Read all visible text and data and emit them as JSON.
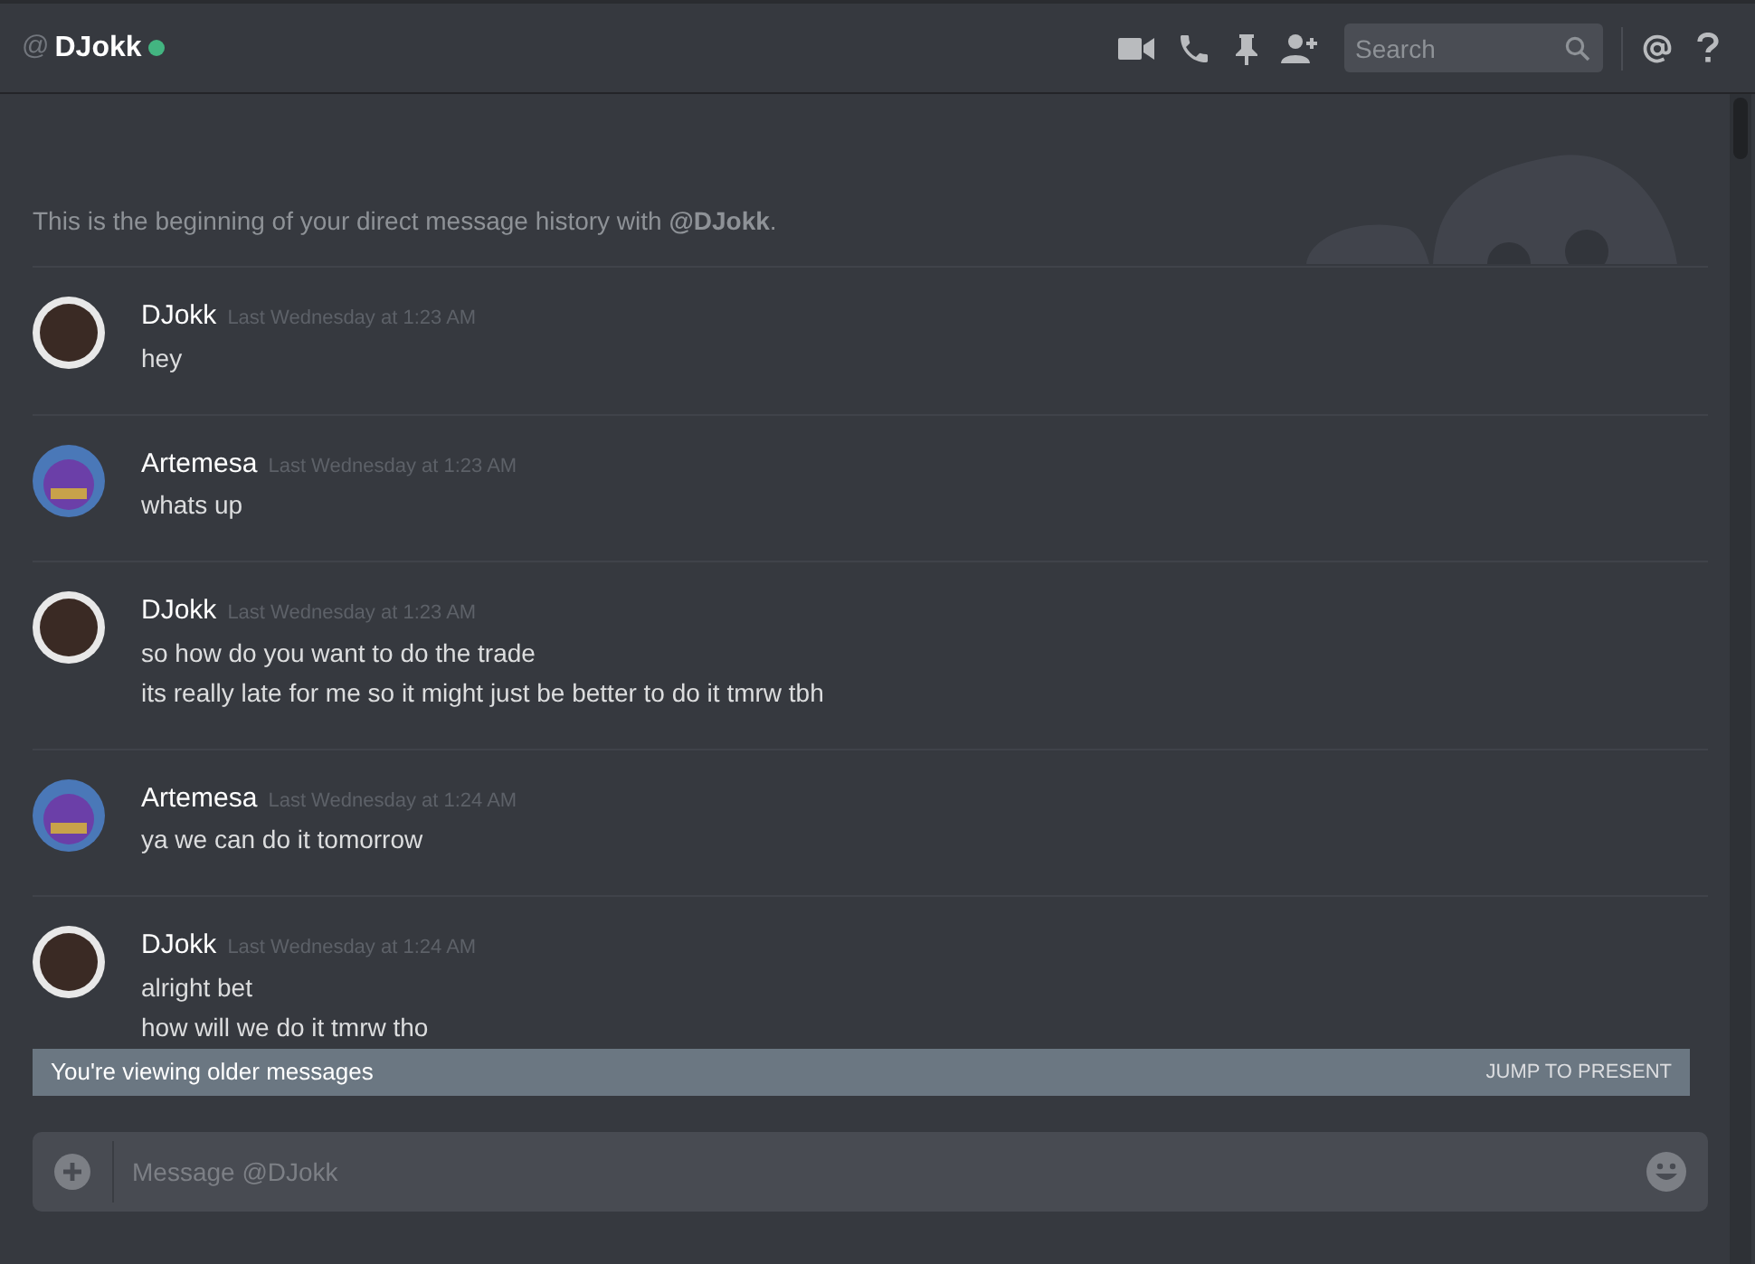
{
  "header": {
    "at": "@",
    "name": "DJokk",
    "online": true,
    "search": {
      "placeholder": "Search"
    }
  },
  "intro": "This is the beginning of your direct message history with **@DJokk**.",
  "messages": [
    {
      "author": "DJokk",
      "kind": "photo",
      "time": "Last Wednesday at 1:23 AM",
      "lines": [
        "hey"
      ]
    },
    {
      "author": "Artemesa",
      "kind": "cartoon",
      "time": "Last Wednesday at 1:23 AM",
      "lines": [
        "whats up"
      ]
    },
    {
      "author": "DJokk",
      "kind": "photo",
      "time": "Last Wednesday at 1:23 AM",
      "lines": [
        "so how do you want to do the trade",
        "its really late for me so it might just be better to do it tmrw tbh"
      ]
    },
    {
      "author": "Artemesa",
      "kind": "cartoon",
      "time": "Last Wednesday at 1:24 AM",
      "lines": [
        "ya we can do it tomorrow"
      ]
    },
    {
      "author": "DJokk",
      "kind": "photo",
      "time": "Last Wednesday at 1:24 AM",
      "lines": [
        "alright bet",
        "how will we do it tmrw tho"
      ]
    }
  ],
  "older_bar": {
    "text": "You're viewing older messages",
    "action": "JUMP TO PRESENT"
  },
  "composer": {
    "placeholder": "Message @DJokk"
  }
}
